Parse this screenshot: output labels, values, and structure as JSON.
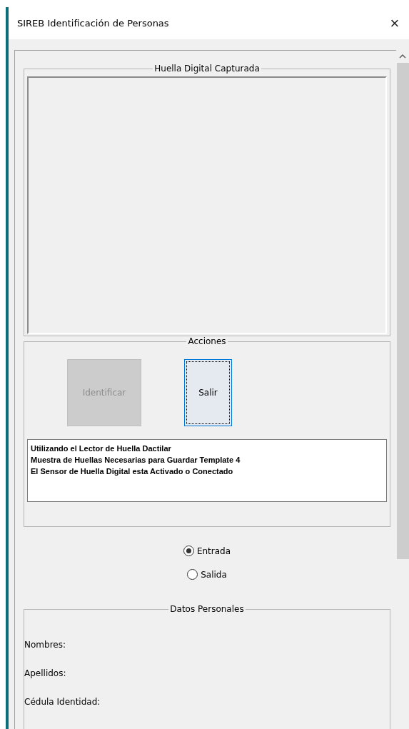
{
  "window": {
    "title": "SIREB Identificación de Personas",
    "close": "×"
  },
  "capture_group": {
    "title": "Huella Digital Capturada"
  },
  "actions_group": {
    "title": "Acciones",
    "buttons": [
      {
        "label": "Identificar",
        "disabled": true,
        "focused": false
      },
      {
        "label": "Salir",
        "disabled": false,
        "focused": true
      }
    ],
    "messages": [
      "Utilizando el Lector de Huella Dactilar",
      "Muestra de Huellas Necesarias para Guardar Template 4",
      "El Sensor de Huella Digital esta Activado o Conectado"
    ]
  },
  "mode": [
    {
      "label": "Entrada",
      "selected": true
    },
    {
      "label": "Salida",
      "selected": false
    }
  ],
  "personal_group": {
    "title": "Datos Personales",
    "fields": [
      "Nombres:",
      "Apellidos:",
      "Cédula Identidad:"
    ]
  }
}
